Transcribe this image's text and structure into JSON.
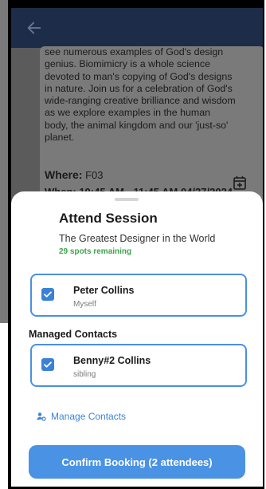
{
  "event": {
    "description": "see numerous examples of God's design genius. Biomimicry is a whole science devoted to man's copying of God's designs in nature. Join us for a celebration of God's wide-ranging creative brilliance and wisdom as we explore examples in the human body, the animal kingdom and our 'just-so' planet.",
    "where_label": "Where:",
    "where_value": "F03",
    "when_label": "When: 10:45 AM - 11:45 AM 04/27/2024"
  },
  "sheet": {
    "title": "Attend Session",
    "subtitle": "The Greatest Designer in the World",
    "spots": "29 spots remaining",
    "managed_label": "Managed Contacts",
    "manage_link": "Manage Contacts",
    "confirm": "Confirm Booking (2 attendees)",
    "contacts": [
      {
        "name": "Peter Collins",
        "relation": "Myself",
        "checked": true
      },
      {
        "name": "Benny#2 Collins",
        "relation": "sibling",
        "checked": true
      }
    ]
  },
  "colors": {
    "appbar": "#1c2c49",
    "accent": "#4a92e3",
    "spots": "#3fa34d",
    "overlay": "#5b5b5b"
  },
  "icons": {
    "back": "arrow-left-icon",
    "calendar": "calendar-add-icon",
    "checkbox": "checkbox-checked-icon",
    "manage": "people-settings-icon"
  }
}
